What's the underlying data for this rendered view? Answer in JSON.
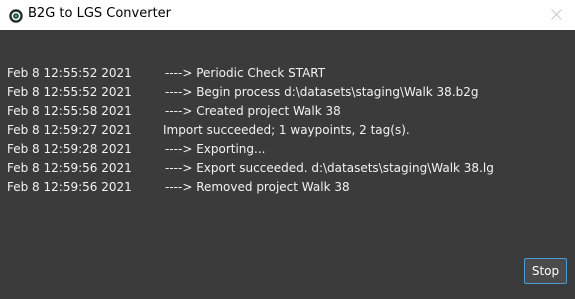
{
  "window": {
    "title": "B2G to LGS Converter",
    "icon": "app-logo-icon",
    "close_icon": "close-icon"
  },
  "log": {
    "lines": [
      {
        "timestamp": "Feb  8 12:55:52 2021",
        "message": "----> Periodic Check START"
      },
      {
        "timestamp": "Feb  8 12:55:52 2021",
        "message": "----> Begin process d:\\datasets\\staging\\Walk 38.b2g"
      },
      {
        "timestamp": "Feb  8 12:55:58 2021",
        "message": "----> Created project Walk 38"
      },
      {
        "timestamp": "Feb  8 12:59:27 2021",
        "message": "Import succeeded; 1 waypoints, 2 tag(s)."
      },
      {
        "timestamp": "Feb  8 12:59:28 2021",
        "message": "----> Exporting..."
      },
      {
        "timestamp": "Feb  8 12:59:56 2021",
        "message": "----> Export succeeded. d:\\datasets\\staging\\Walk 38.lg"
      },
      {
        "timestamp": "Feb  8 12:59:56 2021",
        "message": "----> Removed project Walk 38"
      }
    ]
  },
  "buttons": {
    "stop_label": "Stop"
  },
  "colors": {
    "background": "#3b3b3b",
    "text": "#f2f2f2",
    "button_border": "#4a9bd6"
  }
}
